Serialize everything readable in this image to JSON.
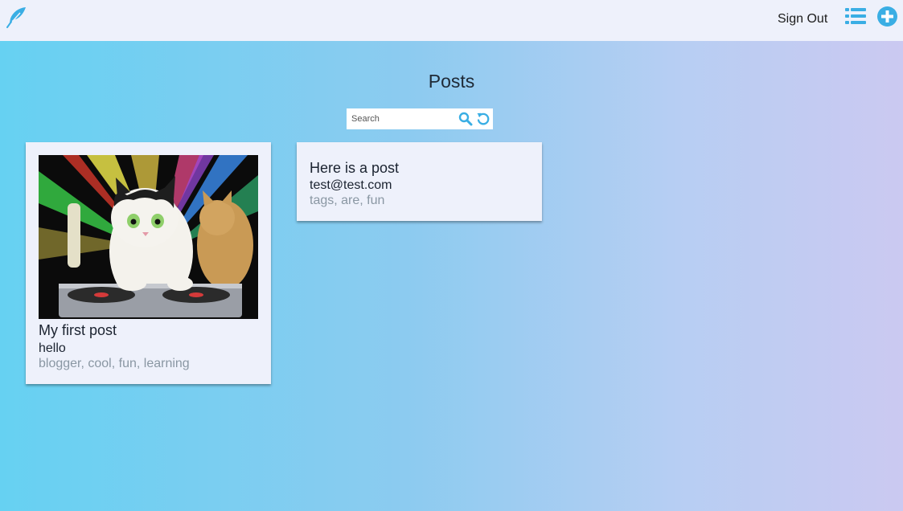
{
  "header": {
    "sign_out_label": "Sign Out",
    "accent_color": "#3aaee4"
  },
  "page": {
    "title": "Posts"
  },
  "search": {
    "placeholder": "Search",
    "value": ""
  },
  "posts": [
    {
      "title": "My first post",
      "body": "hello",
      "tags": "blogger, cool, fun, learning",
      "image": "dj-cat-disco-lights"
    },
    {
      "title": "Here is a post",
      "body": "test@test.com",
      "tags": "tags, are, fun"
    }
  ]
}
